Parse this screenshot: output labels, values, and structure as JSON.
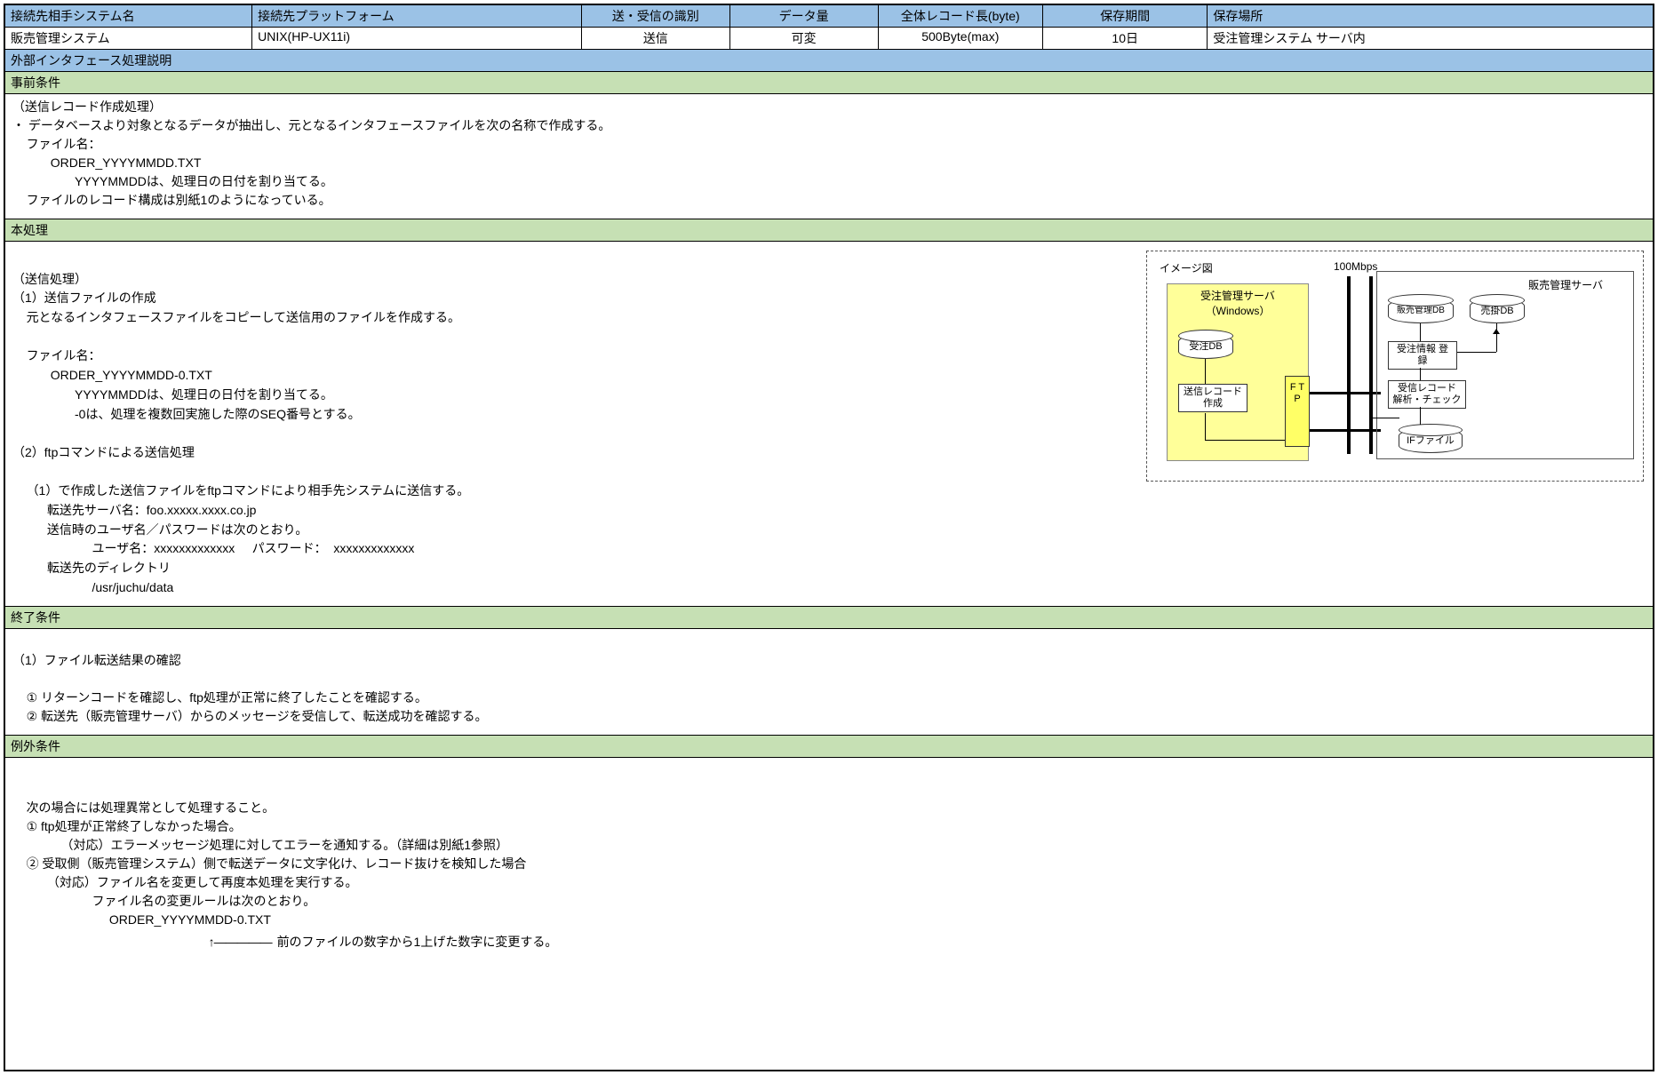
{
  "header": {
    "labels": {
      "c1": "接続先相手システム名",
      "c2": "接続先プラットフォーム",
      "c3": "送・受信の識別",
      "c4": "データ量",
      "c5": "全体レコード長(byte)",
      "c6": "保存期間",
      "c7": "保存場所"
    },
    "values": {
      "c1": "販売管理システム",
      "c2": "UNIX(HP-UX11i)",
      "c3": "送信",
      "c4": "可変",
      "c5": "500Byte(max)",
      "c6": "10日",
      "c7": "受注管理システム サーバ内"
    }
  },
  "bar_interface": "外部インタフェース処理説明",
  "pre": {
    "title": "事前条件",
    "body": "（送信レコード作成処理）\n・ データベースより対象となるデータが抽出し、元となるインタフェースファイルを次の名称で作成する。\n    ファイル名：\n           ORDER_YYYYMMDD.TXT\n                  YYYYMMDDは、処理日の日付を割り当てる。\n    ファイルのレコード構成は別紙1のようになっている。"
  },
  "main": {
    "title": "本処理",
    "body": "\n（送信処理）\n（1）送信ファイルの作成\n    元となるインタフェースファイルをコピーして送信用のファイルを作成する。\n\n    ファイル名：\n           ORDER_YYYYMMDD-0.TXT\n                  YYYYMMDDは、処理日の日付を割り当てる。\n                  -0は、処理を複数回実施した際のSEQ番号とする。\n\n（2）ftpコマンドによる送信処理\n\n    （1）で作成した送信ファイルをftpコマンドにより相手先システムに送信する。\n          転送先サーバ名：foo.xxxxx.xxxx.co.jp\n          送信時のユーザ名／パスワードは次のとおり。\n                       ユーザ名：xxxxxxxxxxxxx     パスワード：  xxxxxxxxxxxxx\n          転送先のディレクトリ\n                       /usr/juchu/data\n"
  },
  "diagram": {
    "caption": "イメージ図",
    "speed": "100Mbps",
    "left_server_1": "受注管理サーバ",
    "left_server_2": "（Windows）",
    "left_db": "受注DB",
    "left_proc": "送信レコード\n作成",
    "ftp": "F\nT\nP",
    "right_server": "販売管理サーバ",
    "right_db1": "販売管理DB",
    "right_db2": "売掛DB",
    "right_proc1": "受注情報\n登録",
    "right_proc2": "受信レコード\n解析・チェック",
    "right_if": "IFファイル"
  },
  "end": {
    "title": "終了条件",
    "body": "\n（1）ファイル転送結果の確認\n\n    ① リターンコードを確認し、ftp処理が正常に終了したことを確認する。\n    ② 転送先（販売管理サーバ）からのメッセージを受信して、転送成功を確認する。\n"
  },
  "exc": {
    "title": "例外条件",
    "body": "\n    次の場合には処理異常として処理すること。\n    ① ftp処理が正常終了しなかった場合。\n              （対応）エラーメッセージ処理に対してエラーを通知する。（詳細は別紙1参照）\n    ② 受取側（販売管理システム）側で転送データに文字化け、レコード抜けを検知した場合\n          （対応）ファイル名を変更して再度本処理を実行する。\n                       ファイル名の変更ルールは次のとおり。\n                            ORDER_YYYYMMDD-0.TXT",
    "arrow_note": "前のファイルの数字から1上げた数字に変更する。"
  }
}
